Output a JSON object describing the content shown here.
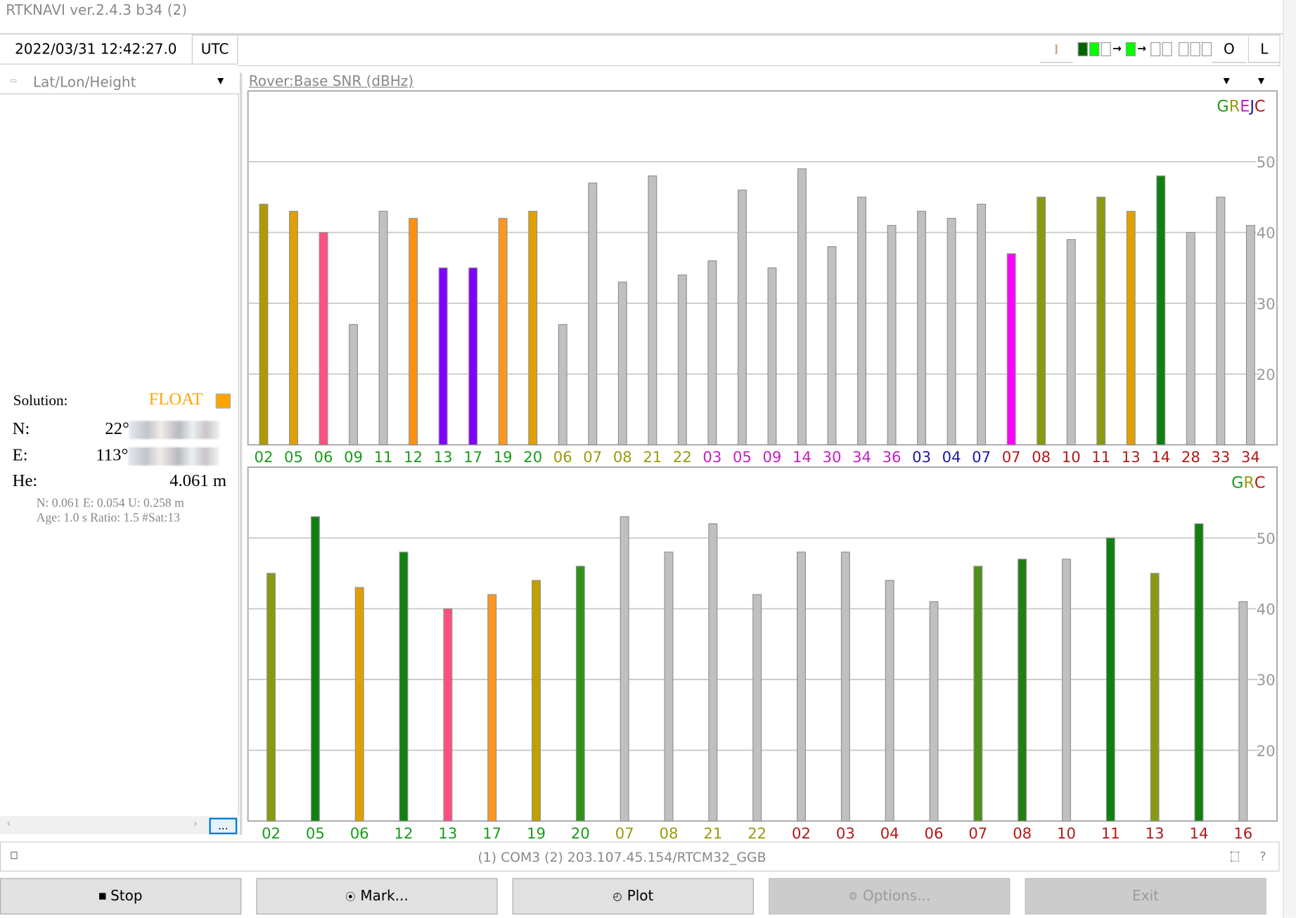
{
  "window": {
    "title": "RTKNAVI ver.2.4.3 b34 (2)"
  },
  "toolbar": {
    "time": "2022/03/31 12:42:27.0",
    "time_system": "UTC",
    "input_btn": "I",
    "output_btn": "O",
    "log_btn": "L",
    "stream_indicator": [
      "#006400",
      "#00ff00",
      "#ffffff",
      "arrow",
      "#00ff00",
      "arrow",
      "#ffffff",
      "#ffffff",
      "gap",
      "#ffffff",
      "#ffffff",
      "#ffffff"
    ]
  },
  "left_panel": {
    "format_select": "Lat/Lon/Height",
    "solution_label": "Solution:",
    "solution_status": "FLOAT",
    "solution_color": "#ffa500",
    "n_label": "N:",
    "n_value": "22°",
    "e_label": "E:",
    "e_value": "113°",
    "he_label": "He:",
    "he_value": "4.061 m",
    "stats_line1": "N: 0.061 E: 0.054 U: 0.258 m",
    "stats_line2": "Age: 1.0 s Ratio: 1.5 #Sat:13",
    "more_button": "..."
  },
  "plot_header": {
    "title": "Rover:Base  SNR (dBHz)"
  },
  "chart_data": [
    {
      "type": "bar",
      "ylim": [
        10,
        60
      ],
      "yticks": [
        20,
        30,
        40,
        50
      ],
      "grid": true,
      "legend": "top-right",
      "legend_letters": [
        {
          "t": "G",
          "c": "#1a9a1a"
        },
        {
          "t": "R",
          "c": "#9a9a10"
        },
        {
          "t": "E",
          "c": "#c020c0"
        },
        {
          "t": "J",
          "c": "#1a1aa0"
        },
        {
          "t": "C",
          "c": "#b01a1a"
        }
      ],
      "categories": [
        "02",
        "05",
        "06",
        "09",
        "11",
        "12",
        "13",
        "17",
        "19",
        "20",
        "06",
        "07",
        "08",
        "21",
        "22",
        "03",
        "05",
        "09",
        "14",
        "30",
        "34",
        "36",
        "03",
        "04",
        "07",
        "07",
        "08",
        "10",
        "11",
        "13",
        "14",
        "28",
        "33",
        "34"
      ],
      "label_colors": [
        "#1a9a1a",
        "#1a9a1a",
        "#1a9a1a",
        "#1a9a1a",
        "#1a9a1a",
        "#1a9a1a",
        "#1a9a1a",
        "#1a9a1a",
        "#1a9a1a",
        "#1a9a1a",
        "#9a9a10",
        "#9a9a10",
        "#9a9a10",
        "#9a9a10",
        "#9a9a10",
        "#c020c0",
        "#c020c0",
        "#c020c0",
        "#c020c0",
        "#c020c0",
        "#c020c0",
        "#c020c0",
        "#1a1aa0",
        "#1a1aa0",
        "#1a1aa0",
        "#b01a1a",
        "#b01a1a",
        "#b01a1a",
        "#b01a1a",
        "#b01a1a",
        "#b01a1a",
        "#b01a1a",
        "#b01a1a",
        "#b01a1a"
      ],
      "values": [
        44,
        43,
        40,
        27,
        43,
        42,
        35,
        35,
        42,
        43,
        27,
        47,
        33,
        48,
        34,
        36,
        46,
        35,
        49,
        38,
        45,
        41,
        43,
        42,
        44,
        37,
        45,
        39,
        45,
        43,
        48,
        40,
        45,
        41
      ],
      "bar_colors": [
        "#b09a00",
        "#e0a000",
        "#ff5080",
        "#c0c0c0",
        "#c0c0c0",
        "#ff9010",
        "#8000ff",
        "#8000ff",
        "#ff9620",
        "#e0a000",
        "#c0c0c0",
        "#c0c0c0",
        "#c0c0c0",
        "#c0c0c0",
        "#c0c0c0",
        "#c0c0c0",
        "#c0c0c0",
        "#c0c0c0",
        "#c0c0c0",
        "#c0c0c0",
        "#c0c0c0",
        "#c0c0c0",
        "#c0c0c0",
        "#c0c0c0",
        "#c0c0c0",
        "#ff00ff",
        "#8a9a10",
        "#c0c0c0",
        "#8a9a10",
        "#e0a000",
        "#108010",
        "#c0c0c0",
        "#c0c0c0",
        "#c0c0c0"
      ]
    },
    {
      "type": "bar",
      "ylim": [
        10,
        60
      ],
      "yticks": [
        20,
        30,
        40,
        50
      ],
      "grid": true,
      "legend": "top-right",
      "legend_letters": [
        {
          "t": "G",
          "c": "#1a9a1a"
        },
        {
          "t": "R",
          "c": "#9a9a10"
        },
        {
          "t": "C",
          "c": "#b01a1a"
        }
      ],
      "categories": [
        "02",
        "05",
        "06",
        "12",
        "13",
        "17",
        "19",
        "20",
        "07",
        "08",
        "21",
        "22",
        "02",
        "03",
        "04",
        "06",
        "07",
        "08",
        "10",
        "11",
        "13",
        "14",
        "16"
      ],
      "label_colors": [
        "#1a9a1a",
        "#1a9a1a",
        "#1a9a1a",
        "#1a9a1a",
        "#1a9a1a",
        "#1a9a1a",
        "#1a9a1a",
        "#1a9a1a",
        "#9a9a10",
        "#9a9a10",
        "#9a9a10",
        "#9a9a10",
        "#b01a1a",
        "#b01a1a",
        "#b01a1a",
        "#b01a1a",
        "#b01a1a",
        "#b01a1a",
        "#b01a1a",
        "#b01a1a",
        "#b01a1a",
        "#b01a1a",
        "#b01a1a"
      ],
      "values": [
        45,
        53,
        43,
        48,
        40,
        42,
        44,
        46,
        53,
        48,
        52,
        42,
        48,
        48,
        44,
        41,
        46,
        47,
        47,
        50,
        45,
        52,
        41
      ],
      "bar_colors": [
        "#8a9a10",
        "#108010",
        "#e0a000",
        "#108010",
        "#ff5080",
        "#ff9620",
        "#c0a000",
        "#30901a",
        "#c0c0c0",
        "#c0c0c0",
        "#c0c0c0",
        "#c0c0c0",
        "#c0c0c0",
        "#c0c0c0",
        "#c0c0c0",
        "#c0c0c0",
        "#50901a",
        "#208010",
        "#c0c0c0",
        "#108010",
        "#8a9a10",
        "#108010",
        "#c0c0c0"
      ]
    }
  ],
  "status_bar": {
    "text": "(1) COM3 (2) 203.107.45.154/RTCM32_GGB",
    "help": "?"
  },
  "buttons": {
    "stop": "Stop",
    "mark": "Mark...",
    "plot": "Plot",
    "options": "Options...",
    "exit": "Exit"
  }
}
